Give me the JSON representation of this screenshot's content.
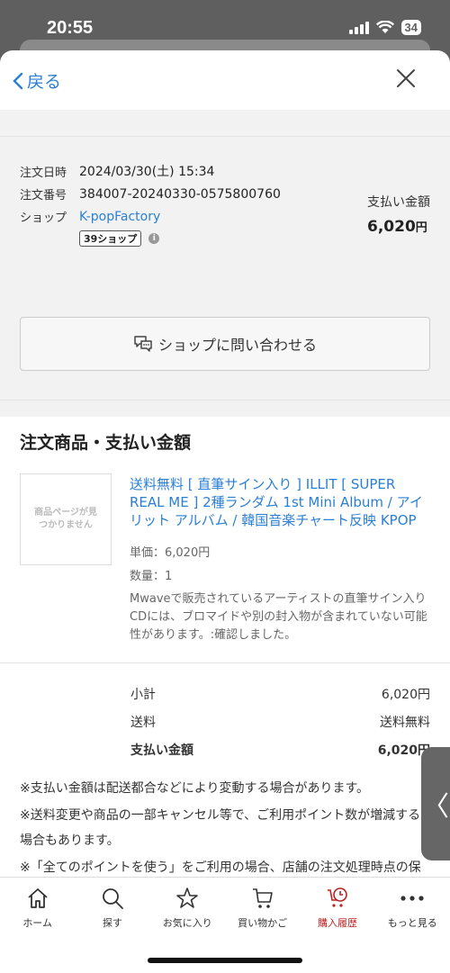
{
  "status": {
    "time": "20:55",
    "battery": "34"
  },
  "topbar": {
    "back_label": "戻る"
  },
  "order": {
    "date_label": "注文日時",
    "date_value": "2024/03/30(土) 15:34",
    "number_label": "注文番号",
    "number_value": "384007-20240330-0575800760",
    "shop_label": "ショップ",
    "shop_value": "K-popFactory",
    "shop_badge": "39ショップ",
    "pay_label": "支払い金額",
    "pay_amount": "6,020",
    "pay_unit": "円"
  },
  "contact": {
    "label": "ショップに問い合わせる"
  },
  "items": {
    "section_title": "注文商品・支払い金額",
    "thumb_text": "商品ページが見つかりません",
    "title": "送料無料 [ 直筆サイン入り ] ILLIT [ SUPER REAL ME ] 2種ランダム 1st Mini Album / アイリット アルバム / 韓国音楽チャート反映 KPOP",
    "unit_price": "単価：6,020円",
    "quantity": "数量：1",
    "note": "Mwaveで販売されているアーティストの直筆サイン入り CDには、ブロマイドや別の封入物が含まれていない可能性があります。:確認しました。"
  },
  "totals": {
    "subtotal_label": "小計",
    "subtotal_value": "6,020円",
    "shipping_label": "送料",
    "shipping_value": "送料無料",
    "pay_label": "支払い金額",
    "pay_value": "6,020円"
  },
  "notes": [
    "※支払い金額は配送都合などにより変動する場合があります。",
    "※送料変更や商品の一部キャンセル等で、ご利用ポイント数が増減する場合もあります。",
    "※「全てのポイントを使う」をご利用の場合、店舗の注文処理時点の保有ポイントが利用対象となり、注文後に保有ポイントが増"
  ],
  "side_tab": {
    "glyph": "〈"
  },
  "nav": [
    {
      "label": "ホーム",
      "icon": "home-icon"
    },
    {
      "label": "探す",
      "icon": "search-icon"
    },
    {
      "label": "お気に入り",
      "icon": "star-icon"
    },
    {
      "label": "買い物かご",
      "icon": "cart-icon"
    },
    {
      "label": "購入履歴",
      "icon": "history-icon"
    },
    {
      "label": "もっと見る",
      "icon": "more-icon"
    }
  ],
  "colors": {
    "link": "#2a7fd4",
    "active": "#b22222",
    "sheet_bg": "#f2f2f2"
  }
}
